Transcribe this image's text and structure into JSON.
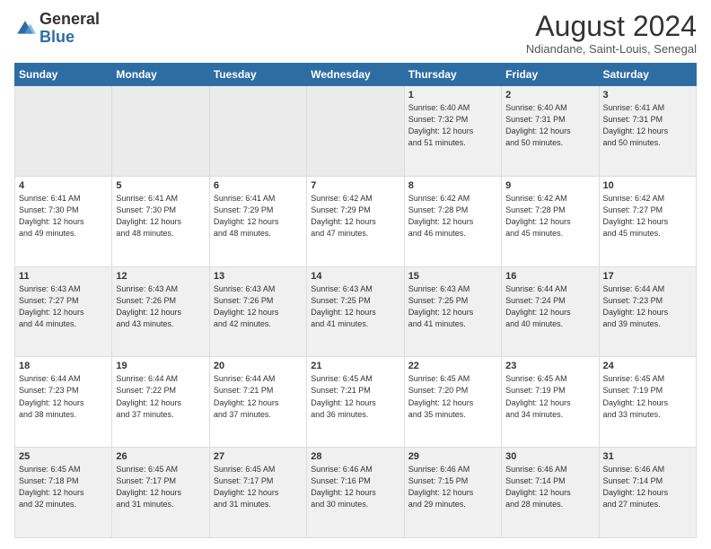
{
  "logo": {
    "general": "General",
    "blue": "Blue"
  },
  "header": {
    "month": "August 2024",
    "location": "Ndiandane, Saint-Louis, Senegal"
  },
  "weekdays": [
    "Sunday",
    "Monday",
    "Tuesday",
    "Wednesday",
    "Thursday",
    "Friday",
    "Saturday"
  ],
  "weeks": [
    [
      {
        "day": "",
        "info": ""
      },
      {
        "day": "",
        "info": ""
      },
      {
        "day": "",
        "info": ""
      },
      {
        "day": "",
        "info": ""
      },
      {
        "day": "1",
        "info": "Sunrise: 6:40 AM\nSunset: 7:32 PM\nDaylight: 12 hours\nand 51 minutes."
      },
      {
        "day": "2",
        "info": "Sunrise: 6:40 AM\nSunset: 7:31 PM\nDaylight: 12 hours\nand 50 minutes."
      },
      {
        "day": "3",
        "info": "Sunrise: 6:41 AM\nSunset: 7:31 PM\nDaylight: 12 hours\nand 50 minutes."
      }
    ],
    [
      {
        "day": "4",
        "info": "Sunrise: 6:41 AM\nSunset: 7:30 PM\nDaylight: 12 hours\nand 49 minutes."
      },
      {
        "day": "5",
        "info": "Sunrise: 6:41 AM\nSunset: 7:30 PM\nDaylight: 12 hours\nand 48 minutes."
      },
      {
        "day": "6",
        "info": "Sunrise: 6:41 AM\nSunset: 7:29 PM\nDaylight: 12 hours\nand 48 minutes."
      },
      {
        "day": "7",
        "info": "Sunrise: 6:42 AM\nSunset: 7:29 PM\nDaylight: 12 hours\nand 47 minutes."
      },
      {
        "day": "8",
        "info": "Sunrise: 6:42 AM\nSunset: 7:28 PM\nDaylight: 12 hours\nand 46 minutes."
      },
      {
        "day": "9",
        "info": "Sunrise: 6:42 AM\nSunset: 7:28 PM\nDaylight: 12 hours\nand 45 minutes."
      },
      {
        "day": "10",
        "info": "Sunrise: 6:42 AM\nSunset: 7:27 PM\nDaylight: 12 hours\nand 45 minutes."
      }
    ],
    [
      {
        "day": "11",
        "info": "Sunrise: 6:43 AM\nSunset: 7:27 PM\nDaylight: 12 hours\nand 44 minutes."
      },
      {
        "day": "12",
        "info": "Sunrise: 6:43 AM\nSunset: 7:26 PM\nDaylight: 12 hours\nand 43 minutes."
      },
      {
        "day": "13",
        "info": "Sunrise: 6:43 AM\nSunset: 7:26 PM\nDaylight: 12 hours\nand 42 minutes."
      },
      {
        "day": "14",
        "info": "Sunrise: 6:43 AM\nSunset: 7:25 PM\nDaylight: 12 hours\nand 41 minutes."
      },
      {
        "day": "15",
        "info": "Sunrise: 6:43 AM\nSunset: 7:25 PM\nDaylight: 12 hours\nand 41 minutes."
      },
      {
        "day": "16",
        "info": "Sunrise: 6:44 AM\nSunset: 7:24 PM\nDaylight: 12 hours\nand 40 minutes."
      },
      {
        "day": "17",
        "info": "Sunrise: 6:44 AM\nSunset: 7:23 PM\nDaylight: 12 hours\nand 39 minutes."
      }
    ],
    [
      {
        "day": "18",
        "info": "Sunrise: 6:44 AM\nSunset: 7:23 PM\nDaylight: 12 hours\nand 38 minutes."
      },
      {
        "day": "19",
        "info": "Sunrise: 6:44 AM\nSunset: 7:22 PM\nDaylight: 12 hours\nand 37 minutes."
      },
      {
        "day": "20",
        "info": "Sunrise: 6:44 AM\nSunset: 7:21 PM\nDaylight: 12 hours\nand 37 minutes."
      },
      {
        "day": "21",
        "info": "Sunrise: 6:45 AM\nSunset: 7:21 PM\nDaylight: 12 hours\nand 36 minutes."
      },
      {
        "day": "22",
        "info": "Sunrise: 6:45 AM\nSunset: 7:20 PM\nDaylight: 12 hours\nand 35 minutes."
      },
      {
        "day": "23",
        "info": "Sunrise: 6:45 AM\nSunset: 7:19 PM\nDaylight: 12 hours\nand 34 minutes."
      },
      {
        "day": "24",
        "info": "Sunrise: 6:45 AM\nSunset: 7:19 PM\nDaylight: 12 hours\nand 33 minutes."
      }
    ],
    [
      {
        "day": "25",
        "info": "Sunrise: 6:45 AM\nSunset: 7:18 PM\nDaylight: 12 hours\nand 32 minutes."
      },
      {
        "day": "26",
        "info": "Sunrise: 6:45 AM\nSunset: 7:17 PM\nDaylight: 12 hours\nand 31 minutes."
      },
      {
        "day": "27",
        "info": "Sunrise: 6:45 AM\nSunset: 7:17 PM\nDaylight: 12 hours\nand 31 minutes."
      },
      {
        "day": "28",
        "info": "Sunrise: 6:46 AM\nSunset: 7:16 PM\nDaylight: 12 hours\nand 30 minutes."
      },
      {
        "day": "29",
        "info": "Sunrise: 6:46 AM\nSunset: 7:15 PM\nDaylight: 12 hours\nand 29 minutes."
      },
      {
        "day": "30",
        "info": "Sunrise: 6:46 AM\nSunset: 7:14 PM\nDaylight: 12 hours\nand 28 minutes."
      },
      {
        "day": "31",
        "info": "Sunrise: 6:46 AM\nSunset: 7:14 PM\nDaylight: 12 hours\nand 27 minutes."
      }
    ]
  ]
}
